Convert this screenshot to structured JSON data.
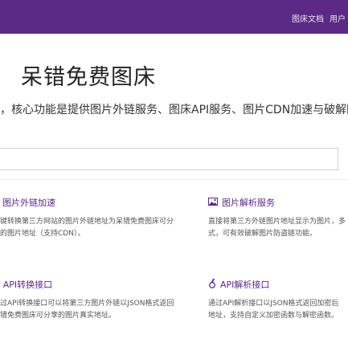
{
  "header": {
    "nav_items": [
      "图床文档",
      "用户"
    ]
  },
  "hero": {
    "title": "呆错免费图床",
    "subtitle": "，核心功能是提供图片外链服务、图床API服务、图片CDN加速与破解防"
  },
  "search": {
    "value": "",
    "placeholder": ""
  },
  "features": [
    {
      "icon": "link-icon",
      "title": "图片外链加速",
      "desc": [
        "键转换第三方网站的图片外链地址为呆错免费图床可分",
        "的图片地址（支持CDN）。"
      ]
    },
    {
      "icon": "image-icon",
      "title": "图片解析服务",
      "desc": [
        "直接将第三方外链图片地址显示为图片，多",
        "式，可有效破解图片防盗链功能。"
      ]
    },
    {
      "icon": "code-icon",
      "title": "API转换接口",
      "desc": [
        "过API转换接口可以将第三方图片外链以JSON格式返回",
        "错免费图床可分享的图片真实地址。"
      ]
    },
    {
      "icon": "medal-icon",
      "title": "API解析接口",
      "desc": [
        "通过API解析接口以JSON格式返回加密后",
        "地址，支持自定义加密函数与解密函数。"
      ]
    }
  ],
  "colors": {
    "brand": "#5b2a86",
    "nav_text": "#e8e0f2"
  }
}
